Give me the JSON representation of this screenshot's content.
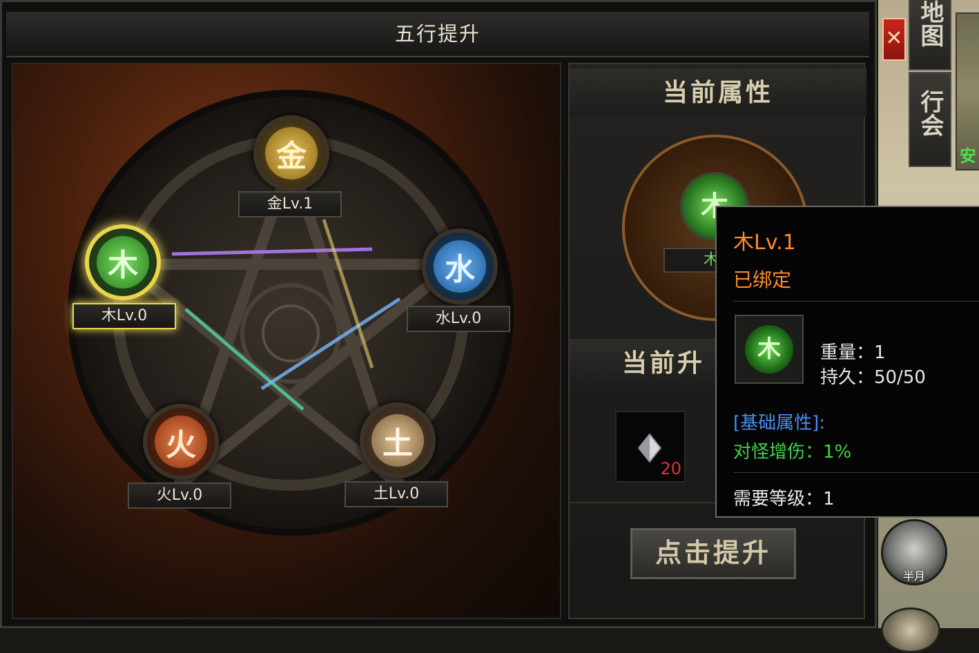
{
  "dialog": {
    "title": "五行提升",
    "close_symbol": "✕"
  },
  "elements": [
    {
      "key": "metal",
      "glyph": "金",
      "label": "金Lv.1",
      "color": "#d9ad3c",
      "active": false
    },
    {
      "key": "wood",
      "glyph": "木",
      "label": "木Lv.0",
      "color": "#4fc84a",
      "active": true
    },
    {
      "key": "water",
      "glyph": "水",
      "label": "水Lv.0",
      "color": "#3a8ad8",
      "active": false
    },
    {
      "key": "fire",
      "glyph": "火",
      "label": "火Lv.0",
      "color": "#d8602a",
      "active": false
    },
    {
      "key": "earth",
      "glyph": "土",
      "label": "土Lv.0",
      "color": "#c8a878",
      "active": false
    }
  ],
  "right_panel": {
    "current_attr_title": "当前属性",
    "medallion_label": "木L",
    "next_title": "当前升",
    "material_qty": "20",
    "upgrade_button": "点击提升"
  },
  "tooltip": {
    "name": "木Lv.1",
    "bound": "已绑定",
    "weight": "重量：1",
    "durability": "持久：50/50",
    "base_attr_header": "[基础属性]:",
    "base_attr_value": "对怪增伤：1%",
    "required_level": "需要等级：1"
  },
  "side": {
    "tab_map": "地图",
    "tab_guild": "行会",
    "thumb_label": "安",
    "skill_label": "半月"
  },
  "colors": {
    "active_glow": "#f2e060",
    "tooltip_orange": "#ff8a2a",
    "attr_blue": "#4a8ef0",
    "attr_green": "#40d24a"
  }
}
